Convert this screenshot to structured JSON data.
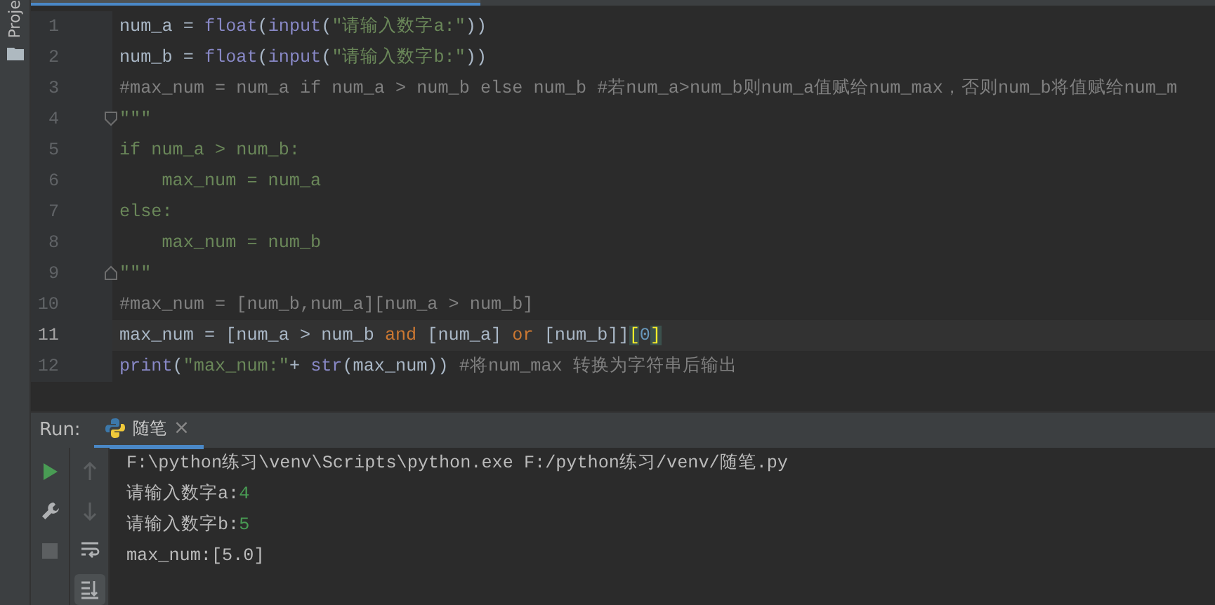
{
  "sidebar": {
    "label": "Proje"
  },
  "editor": {
    "lines": [
      {
        "number": "1",
        "current": false,
        "tokens": [
          {
            "kind": "name",
            "text": "num_a = "
          },
          {
            "kind": "builtin",
            "text": "float"
          },
          {
            "kind": "name",
            "text": "("
          },
          {
            "kind": "builtin",
            "text": "input"
          },
          {
            "kind": "name",
            "text": "("
          },
          {
            "kind": "string",
            "text": "\"请输入数字a:\""
          },
          {
            "kind": "name",
            "text": "))"
          }
        ]
      },
      {
        "number": "2",
        "current": false,
        "tokens": [
          {
            "kind": "name",
            "text": "num_b = "
          },
          {
            "kind": "builtin",
            "text": "float"
          },
          {
            "kind": "name",
            "text": "("
          },
          {
            "kind": "builtin",
            "text": "input"
          },
          {
            "kind": "name",
            "text": "("
          },
          {
            "kind": "string",
            "text": "\"请输入数字b:\""
          },
          {
            "kind": "name",
            "text": "))"
          }
        ]
      },
      {
        "number": "3",
        "current": false,
        "tokens": [
          {
            "kind": "comment",
            "text": "#max_num = num_a if num_a > num_b else num_b #若num_a>num_b则num_a值赋给num_max，否则num_b将值赋给num_m"
          }
        ]
      },
      {
        "number": "4",
        "current": false,
        "kind": "fold_start",
        "tokens": [
          {
            "kind": "string",
            "text": "\"\"\""
          }
        ]
      },
      {
        "number": "5",
        "current": false,
        "tokens": [
          {
            "kind": "string",
            "text": "if num_a > num_b:"
          }
        ]
      },
      {
        "number": "6",
        "current": false,
        "tokens": [
          {
            "kind": "string",
            "text": "    max_num = num_a"
          }
        ]
      },
      {
        "number": "7",
        "current": false,
        "tokens": [
          {
            "kind": "string",
            "text": "else:"
          }
        ]
      },
      {
        "number": "8",
        "current": false,
        "tokens": [
          {
            "kind": "string",
            "text": "    max_num = num_b"
          }
        ]
      },
      {
        "number": "9",
        "current": false,
        "kind": "fold_end",
        "tokens": [
          {
            "kind": "string",
            "text": "\"\"\""
          }
        ]
      },
      {
        "number": "10",
        "current": false,
        "tokens": [
          {
            "kind": "comment",
            "text": "#max_num = [num_b,num_a][num_a > num_b]"
          }
        ]
      },
      {
        "number": "11",
        "current": true,
        "tokens": [
          {
            "kind": "name",
            "text": "max_num = [num_a > num_b "
          },
          {
            "kind": "keyword",
            "text": "and"
          },
          {
            "kind": "name",
            "text": " [num_a] "
          },
          {
            "kind": "keyword",
            "text": "or"
          },
          {
            "kind": "name",
            "text": " [num_b]]"
          },
          {
            "kind": "brace",
            "text": "["
          },
          {
            "kind": "number",
            "text": "0"
          },
          {
            "kind": "brace",
            "text": "]"
          }
        ]
      },
      {
        "number": "12",
        "current": false,
        "tokens": [
          {
            "kind": "builtin",
            "text": "print"
          },
          {
            "kind": "name",
            "text": "("
          },
          {
            "kind": "string",
            "text": "\"max_num:\""
          },
          {
            "kind": "name",
            "text": "+ "
          },
          {
            "kind": "builtin",
            "text": "str"
          },
          {
            "kind": "name",
            "text": "(max_num)) "
          },
          {
            "kind": "comment",
            "text": "#将num_max 转换为字符串后输出"
          }
        ]
      }
    ]
  },
  "run_panel": {
    "label": "Run:",
    "tabs": [
      {
        "label": "随笔",
        "selected": true,
        "close": "×"
      }
    ],
    "console": [
      {
        "tokens": [
          {
            "kind": "output",
            "text": "F:\\python练习\\venv\\Scripts\\python.exe F:/python练习/venv/随笔.py"
          }
        ]
      },
      {
        "tokens": [
          {
            "kind": "output",
            "text": "请输入数字a:"
          },
          {
            "kind": "input",
            "text": "4"
          }
        ]
      },
      {
        "tokens": [
          {
            "kind": "output",
            "text": "请输入数字b:"
          },
          {
            "kind": "input",
            "text": "5"
          }
        ]
      },
      {
        "tokens": [
          {
            "kind": "output",
            "text": "max_num:[5.0]"
          }
        ]
      }
    ]
  }
}
